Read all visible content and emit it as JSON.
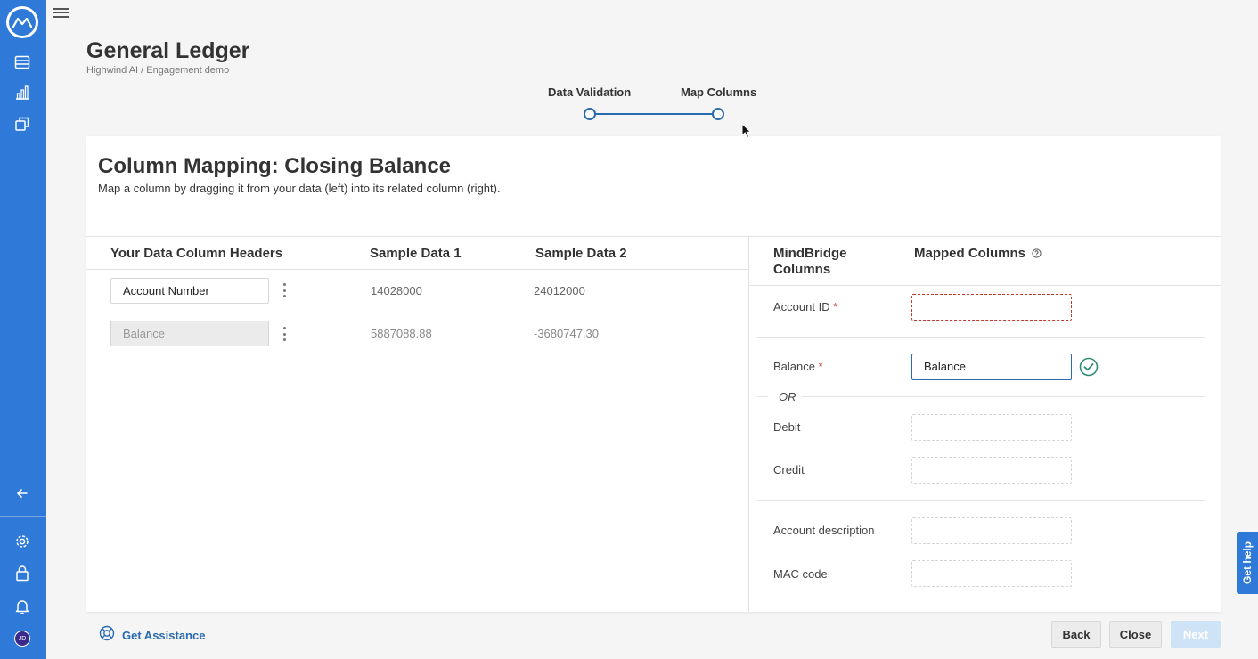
{
  "app": {
    "avatar_initials": "JD"
  },
  "header": {
    "title": "General Ledger",
    "breadcrumb": "Highwind AI / Engagement demo"
  },
  "stepper": {
    "steps": [
      {
        "label": "Data Validation",
        "state": "complete"
      },
      {
        "label": "Map Columns",
        "state": "current"
      }
    ]
  },
  "card": {
    "title": "Column Mapping: Closing Balance",
    "subtitle": "Map a column by dragging it from your data (left) into its related column (right)."
  },
  "source_table": {
    "headers": [
      "Your Data Column Headers",
      "Sample Data 1",
      "Sample Data 2"
    ],
    "rows": [
      {
        "name": "Account Number",
        "sample1": "14028000",
        "sample2": "24012000",
        "mapped": false
      },
      {
        "name": "Balance",
        "sample1": "5887088.88",
        "sample2": "-3680747.30",
        "mapped": true
      }
    ]
  },
  "mapping": {
    "headers": [
      "MindBridge Columns",
      "Mapped Columns"
    ],
    "help_icon": "question-circle-icon",
    "or_label": "OR",
    "fields": [
      {
        "label": "Account ID",
        "required": "*",
        "value": ""
      },
      {
        "label": "Balance",
        "required": "*",
        "value": "Balance"
      },
      {
        "label": "Debit",
        "value": ""
      },
      {
        "label": "Credit",
        "value": ""
      },
      {
        "label": "Account description",
        "value": ""
      },
      {
        "label": "MAC code",
        "value": ""
      }
    ]
  },
  "footer": {
    "assist_label": "Get Assistance",
    "back_label": "Back",
    "close_label": "Close",
    "next_label": "Next"
  },
  "help_tab": {
    "label": "Get help"
  },
  "colors": {
    "sidebar": "#2f7ad8",
    "accent": "#2a6bb0",
    "required": "#c0392b",
    "success": "#2e8b74"
  }
}
